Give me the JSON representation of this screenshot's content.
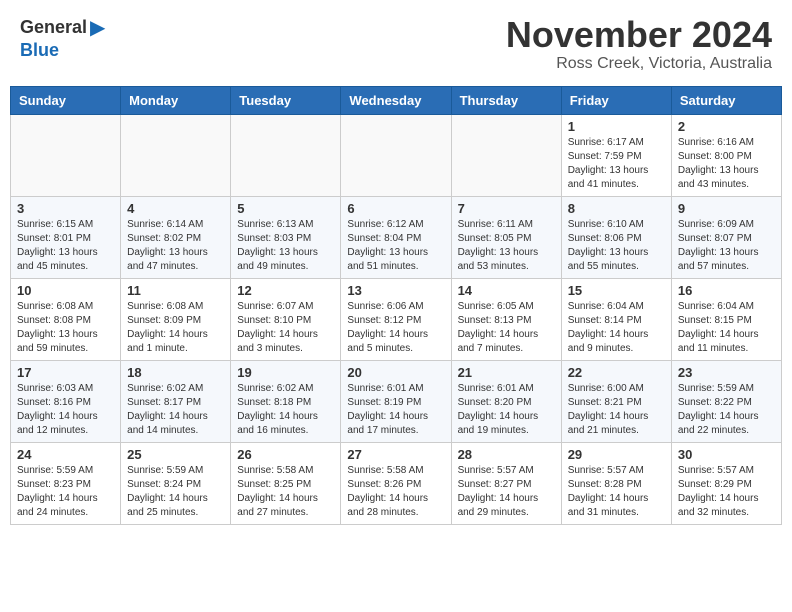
{
  "header": {
    "logo_general": "General",
    "logo_blue": "Blue",
    "month_title": "November 2024",
    "location": "Ross Creek, Victoria, Australia"
  },
  "calendar": {
    "days_of_week": [
      "Sunday",
      "Monday",
      "Tuesday",
      "Wednesday",
      "Thursday",
      "Friday",
      "Saturday"
    ],
    "weeks": [
      [
        {
          "day": "",
          "info": ""
        },
        {
          "day": "",
          "info": ""
        },
        {
          "day": "",
          "info": ""
        },
        {
          "day": "",
          "info": ""
        },
        {
          "day": "",
          "info": ""
        },
        {
          "day": "1",
          "info": "Sunrise: 6:17 AM\nSunset: 7:59 PM\nDaylight: 13 hours\nand 41 minutes."
        },
        {
          "day": "2",
          "info": "Sunrise: 6:16 AM\nSunset: 8:00 PM\nDaylight: 13 hours\nand 43 minutes."
        }
      ],
      [
        {
          "day": "3",
          "info": "Sunrise: 6:15 AM\nSunset: 8:01 PM\nDaylight: 13 hours\nand 45 minutes."
        },
        {
          "day": "4",
          "info": "Sunrise: 6:14 AM\nSunset: 8:02 PM\nDaylight: 13 hours\nand 47 minutes."
        },
        {
          "day": "5",
          "info": "Sunrise: 6:13 AM\nSunset: 8:03 PM\nDaylight: 13 hours\nand 49 minutes."
        },
        {
          "day": "6",
          "info": "Sunrise: 6:12 AM\nSunset: 8:04 PM\nDaylight: 13 hours\nand 51 minutes."
        },
        {
          "day": "7",
          "info": "Sunrise: 6:11 AM\nSunset: 8:05 PM\nDaylight: 13 hours\nand 53 minutes."
        },
        {
          "day": "8",
          "info": "Sunrise: 6:10 AM\nSunset: 8:06 PM\nDaylight: 13 hours\nand 55 minutes."
        },
        {
          "day": "9",
          "info": "Sunrise: 6:09 AM\nSunset: 8:07 PM\nDaylight: 13 hours\nand 57 minutes."
        }
      ],
      [
        {
          "day": "10",
          "info": "Sunrise: 6:08 AM\nSunset: 8:08 PM\nDaylight: 13 hours\nand 59 minutes."
        },
        {
          "day": "11",
          "info": "Sunrise: 6:08 AM\nSunset: 8:09 PM\nDaylight: 14 hours\nand 1 minute."
        },
        {
          "day": "12",
          "info": "Sunrise: 6:07 AM\nSunset: 8:10 PM\nDaylight: 14 hours\nand 3 minutes."
        },
        {
          "day": "13",
          "info": "Sunrise: 6:06 AM\nSunset: 8:12 PM\nDaylight: 14 hours\nand 5 minutes."
        },
        {
          "day": "14",
          "info": "Sunrise: 6:05 AM\nSunset: 8:13 PM\nDaylight: 14 hours\nand 7 minutes."
        },
        {
          "day": "15",
          "info": "Sunrise: 6:04 AM\nSunset: 8:14 PM\nDaylight: 14 hours\nand 9 minutes."
        },
        {
          "day": "16",
          "info": "Sunrise: 6:04 AM\nSunset: 8:15 PM\nDaylight: 14 hours\nand 11 minutes."
        }
      ],
      [
        {
          "day": "17",
          "info": "Sunrise: 6:03 AM\nSunset: 8:16 PM\nDaylight: 14 hours\nand 12 minutes."
        },
        {
          "day": "18",
          "info": "Sunrise: 6:02 AM\nSunset: 8:17 PM\nDaylight: 14 hours\nand 14 minutes."
        },
        {
          "day": "19",
          "info": "Sunrise: 6:02 AM\nSunset: 8:18 PM\nDaylight: 14 hours\nand 16 minutes."
        },
        {
          "day": "20",
          "info": "Sunrise: 6:01 AM\nSunset: 8:19 PM\nDaylight: 14 hours\nand 17 minutes."
        },
        {
          "day": "21",
          "info": "Sunrise: 6:01 AM\nSunset: 8:20 PM\nDaylight: 14 hours\nand 19 minutes."
        },
        {
          "day": "22",
          "info": "Sunrise: 6:00 AM\nSunset: 8:21 PM\nDaylight: 14 hours\nand 21 minutes."
        },
        {
          "day": "23",
          "info": "Sunrise: 5:59 AM\nSunset: 8:22 PM\nDaylight: 14 hours\nand 22 minutes."
        }
      ],
      [
        {
          "day": "24",
          "info": "Sunrise: 5:59 AM\nSunset: 8:23 PM\nDaylight: 14 hours\nand 24 minutes."
        },
        {
          "day": "25",
          "info": "Sunrise: 5:59 AM\nSunset: 8:24 PM\nDaylight: 14 hours\nand 25 minutes."
        },
        {
          "day": "26",
          "info": "Sunrise: 5:58 AM\nSunset: 8:25 PM\nDaylight: 14 hours\nand 27 minutes."
        },
        {
          "day": "27",
          "info": "Sunrise: 5:58 AM\nSunset: 8:26 PM\nDaylight: 14 hours\nand 28 minutes."
        },
        {
          "day": "28",
          "info": "Sunrise: 5:57 AM\nSunset: 8:27 PM\nDaylight: 14 hours\nand 29 minutes."
        },
        {
          "day": "29",
          "info": "Sunrise: 5:57 AM\nSunset: 8:28 PM\nDaylight: 14 hours\nand 31 minutes."
        },
        {
          "day": "30",
          "info": "Sunrise: 5:57 AM\nSunset: 8:29 PM\nDaylight: 14 hours\nand 32 minutes."
        }
      ]
    ]
  }
}
